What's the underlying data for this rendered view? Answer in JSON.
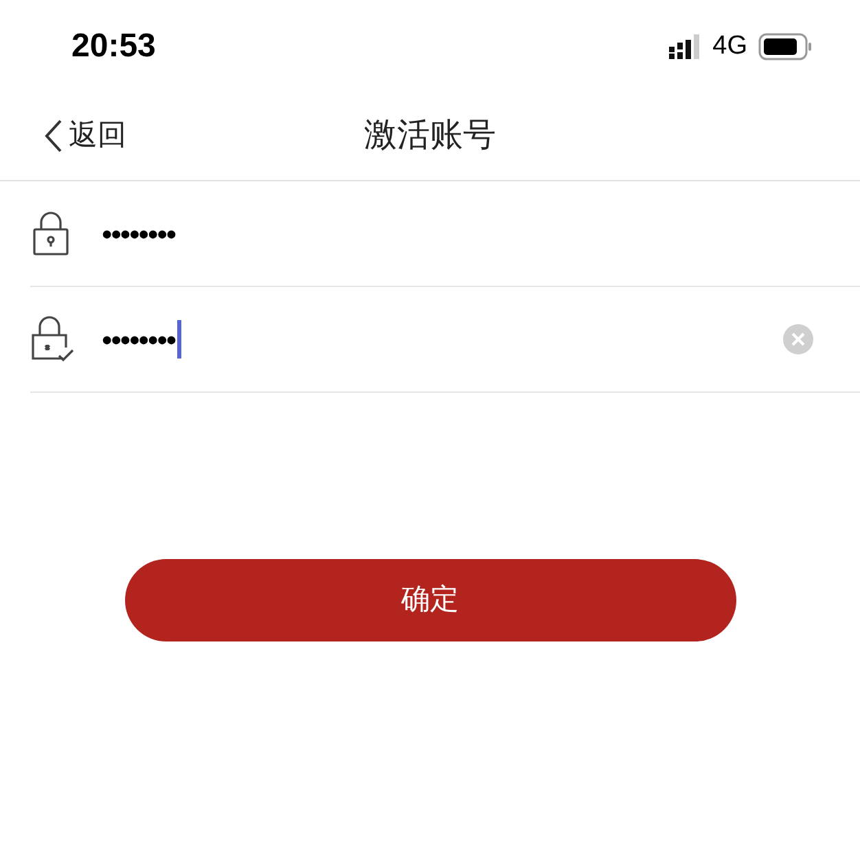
{
  "status_bar": {
    "time": "20:53",
    "network": "4G"
  },
  "nav_bar": {
    "back": "返回",
    "title": "激活账号"
  },
  "fields": [
    {
      "kind": "password",
      "value": "••••••••",
      "focused": false
    },
    {
      "kind": "confirm",
      "value": "••••••••",
      "focused": true
    }
  ],
  "submit_button": "确定"
}
